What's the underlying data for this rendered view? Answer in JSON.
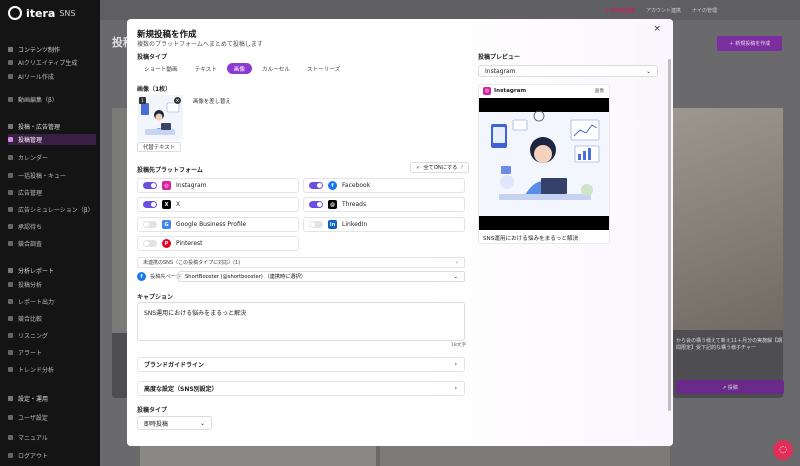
{
  "app": {
    "logo_text": "itera",
    "logo_sub": "SNS",
    "top_right": [
      "ℹ 今月の投稿",
      "アカウント連携",
      "ナイの管理"
    ],
    "bg_title": "投稿管理",
    "bg_create_label": "＋ 新規投稿を作成",
    "bg_caption": "から会の構う様えて新え11＋月分の実施解【期間限定】受下記的な構う様子チャー",
    "bg_button": "↗ 投稿"
  },
  "sidebar": {
    "sections": [
      {
        "title": "コンテンツ制作",
        "items": [
          "AIクリエイティブ生成",
          "AIリール作成",
          "動画編集（β）"
        ]
      },
      {
        "title": "投稿・広告管理",
        "items": [
          "投稿管理",
          "カレンダー",
          "一括投稿・キュー",
          "広告管理",
          "広告シミュレーション（β）",
          "承認待ち",
          "競合調査"
        ]
      },
      {
        "title": "分析レポート",
        "items": [
          "投稿分析",
          "レポート出力",
          "競合比較",
          "リスニング",
          "アラート",
          "トレンド分析"
        ]
      },
      {
        "title": "設定・運用",
        "items": [
          "ユーザ設定"
        ]
      }
    ],
    "footer": [
      "マニュアル",
      "ログアウト"
    ],
    "active_item": "投稿管理"
  },
  "modal": {
    "title": "新規投稿を作成",
    "subtitle": "複数のプラットフォームへまとめて投稿します",
    "close_icon": "×",
    "post_type_label": "投稿タイプ",
    "post_types": [
      "ショート動画",
      "テキスト",
      "画像",
      "カルーセル",
      "ストーリーズ"
    ],
    "post_type_selected": "画像",
    "images_label": "画像（1枚）",
    "thumb_badge": "1",
    "replace_label": "画像を差し替え",
    "alt_text_label": "代替テキスト",
    "platforms_label": "投稿先プラットフォーム",
    "all_on_label": "全てONにする",
    "platforms": [
      {
        "name": "Instagram",
        "on": true,
        "color": "#d6249f",
        "icon": "instagram-icon",
        "glyph": "◎"
      },
      {
        "name": "Facebook",
        "on": true,
        "color": "#1877f2",
        "icon": "facebook-icon",
        "glyph": "f"
      },
      {
        "name": "X",
        "on": true,
        "color": "#000000",
        "icon": "x-icon",
        "glyph": "X"
      },
      {
        "name": "Threads",
        "on": true,
        "color": "#000000",
        "icon": "threads-icon",
        "glyph": "@"
      },
      {
        "name": "Google Business Profile",
        "on": false,
        "color": "#4285f4",
        "icon": "google-business-icon",
        "glyph": "G"
      },
      {
        "name": "LinkedIn",
        "on": false,
        "color": "#0a66c2",
        "icon": "linkedin-icon",
        "glyph": "in"
      },
      {
        "name": "Pinterest",
        "on": false,
        "color": "#e60023",
        "icon": "pinterest-icon",
        "glyph": "P"
      }
    ],
    "unlinked_label": "未連携のSNS（この投稿タイプに対応）(1)",
    "page_label": "投稿先ページ",
    "page_value": "ShortBooster (@shortbooster) （連携時に選択）",
    "caption_label": "キャプション",
    "caption_value": "SNS運用における悩みをまるっと解決",
    "caption_count": "18文字",
    "brand_guideline_label": "ブランドガイドライン",
    "advanced_label": "高度な設定（SNS別設定）",
    "schedule_label": "投稿タイプ",
    "schedule_value": "即時投稿",
    "preview_label": "投稿プレビュー",
    "preview_platform": "Instagram",
    "preview_account": "Instagram",
    "preview_tag": "画像",
    "preview_caption": "SNS運用における悩みをまるっと解決",
    "chevron": "›",
    "chevron_down": "⌄"
  }
}
